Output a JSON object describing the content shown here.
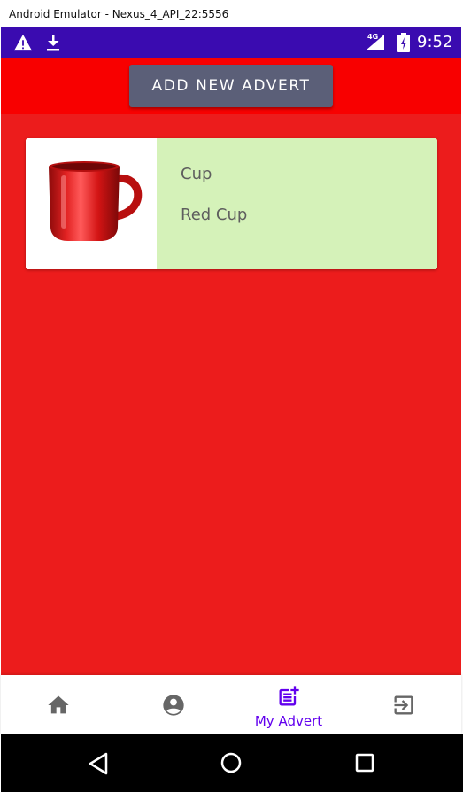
{
  "window": {
    "title": "Android Emulator - Nexus_4_API_22:5556"
  },
  "status_bar": {
    "network": "4G",
    "time": "9:52",
    "icons": [
      "warning-icon",
      "download-icon",
      "signal-icon",
      "battery-icon"
    ]
  },
  "header": {
    "add_button_label": "ADD NEW ADVERT"
  },
  "adverts": [
    {
      "title": "Cup",
      "description": "Red Cup",
      "image": "red-cup"
    }
  ],
  "bottom_nav": {
    "items": [
      {
        "icon": "home-icon",
        "label": ""
      },
      {
        "icon": "account-icon",
        "label": ""
      },
      {
        "icon": "post-add-icon",
        "label": "My Advert",
        "active": true
      },
      {
        "icon": "exit-icon",
        "label": ""
      }
    ]
  },
  "system_nav": {
    "icons": [
      "back-icon",
      "home-circle-icon",
      "recents-icon"
    ]
  },
  "colors": {
    "status_bar": "#3a0bb0",
    "app_header": "#f80000",
    "content_bg": "#ec1c1c",
    "button_bg": "#5b5f78",
    "card_info_bg": "#d5f2b9",
    "nav_active": "#6200ee",
    "nav_inactive": "#666666"
  }
}
